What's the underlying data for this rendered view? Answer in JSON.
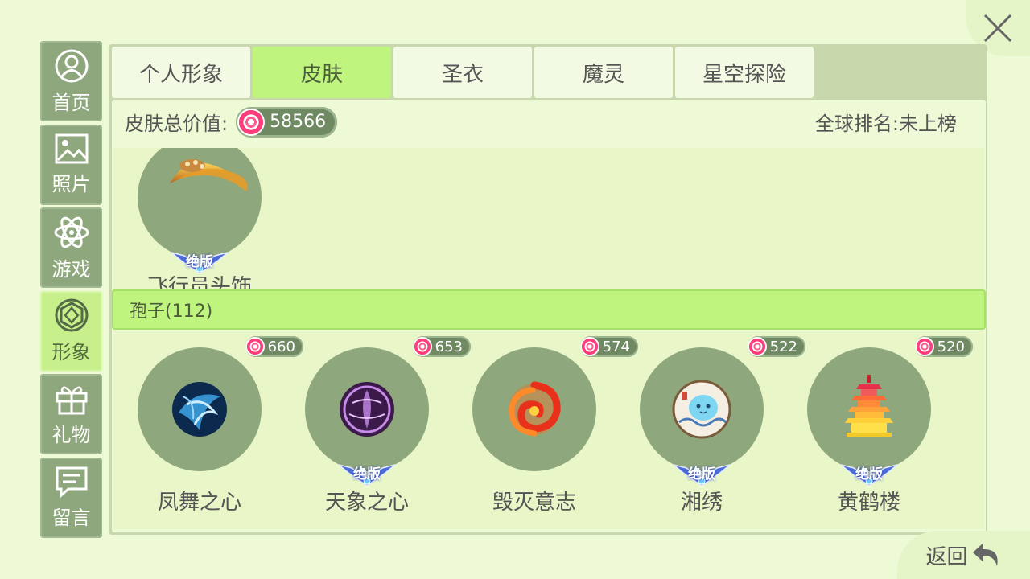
{
  "sidebar": {
    "items": [
      {
        "label": "首页",
        "icon": "user-icon",
        "active": false
      },
      {
        "label": "照片",
        "icon": "image-icon",
        "active": false
      },
      {
        "label": "游戏",
        "icon": "atom-icon",
        "active": false
      },
      {
        "label": "形象",
        "icon": "gem-icon",
        "active": true
      },
      {
        "label": "礼物",
        "icon": "gift-icon",
        "active": false
      },
      {
        "label": "留言",
        "icon": "message-icon",
        "active": false
      }
    ]
  },
  "tabs": [
    {
      "label": "个人形象",
      "active": false
    },
    {
      "label": "皮肤",
      "active": true
    },
    {
      "label": "圣衣",
      "active": false
    },
    {
      "label": "魔灵",
      "active": false
    },
    {
      "label": "星空探险",
      "active": false
    }
  ],
  "summary": {
    "total_label": "皮肤总价值:",
    "total_value": "58566",
    "rank_text": "全球排名:未上榜"
  },
  "section1": {
    "items": [
      {
        "name": "飞行员头饰",
        "badge": "绝版",
        "icon": "pilot-hat-icon"
      }
    ]
  },
  "category": {
    "label": "孢子(112)"
  },
  "section2": {
    "items": [
      {
        "name": "凤舞之心",
        "price": "660",
        "badge": "",
        "icon": "phoenix-orb-icon"
      },
      {
        "name": "天象之心",
        "price": "653",
        "badge": "绝版",
        "icon": "purple-orb-icon"
      },
      {
        "name": "毁灭意志",
        "price": "574",
        "badge": "",
        "icon": "fire-swirl-icon"
      },
      {
        "name": "湘绣",
        "price": "522",
        "badge": "绝版",
        "icon": "embroidery-icon"
      },
      {
        "name": "黄鹤楼",
        "price": "520",
        "badge": "绝版",
        "icon": "pagoda-icon"
      }
    ]
  },
  "back_label": "返回",
  "colors": {
    "background": "#eef9d6",
    "active_green": "#bff47e",
    "sidebar_gray_green": "#8fa77c",
    "candy_pink": "#ff3d7a"
  }
}
